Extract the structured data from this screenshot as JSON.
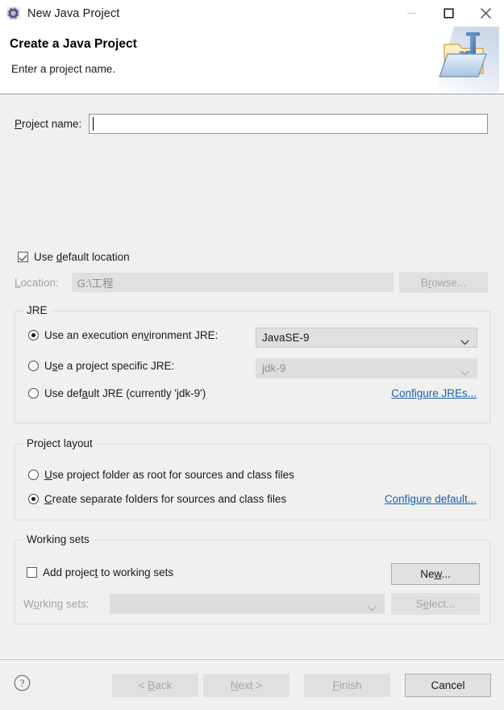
{
  "window": {
    "title": "New Java Project",
    "icon": "eclipse-gear-icon",
    "controls": {
      "minimize": "minimize-icon",
      "maximize": "maximize-icon",
      "close": "close-icon"
    }
  },
  "header": {
    "title": "Create a Java Project",
    "description": "Enter a project name.",
    "icon": "java-project-folder-icon"
  },
  "form": {
    "project_name_label": "Project name:",
    "project_name_value": "",
    "use_default_location_label": "Use default location",
    "use_default_location_checked": true,
    "location_label": "Location:",
    "location_value": "G:\\工程",
    "browse_label": "Browse..."
  },
  "jre": {
    "group_title": "JRE",
    "options": [
      {
        "label": "Use an execution environment JRE:",
        "selected": true,
        "combo_value": "JavaSE-9",
        "combo_enabled": true
      },
      {
        "label": "Use a project specific JRE:",
        "selected": false,
        "combo_value": "jdk-9",
        "combo_enabled": false
      },
      {
        "label": "Use default JRE (currently 'jdk-9')",
        "selected": false
      }
    ],
    "configure_link": "Configure JREs..."
  },
  "project_layout": {
    "group_title": "Project layout",
    "options": [
      {
        "label": "Use project folder as root for sources and class files",
        "selected": false
      },
      {
        "label": "Create separate folders for sources and class files",
        "selected": true
      }
    ],
    "configure_link": "Configure default..."
  },
  "working_sets": {
    "group_title": "Working sets",
    "add_label": "Add project to working sets",
    "add_checked": false,
    "new_label": "New...",
    "sets_label": "Working sets:",
    "sets_value": "",
    "select_label": "Select..."
  },
  "footer": {
    "help_icon": "help-icon",
    "buttons": [
      {
        "label": "< Back",
        "enabled": false
      },
      {
        "label": "Next >",
        "enabled": false
      },
      {
        "label": "Finish",
        "enabled": false
      },
      {
        "label": "Cancel",
        "enabled": true
      }
    ]
  },
  "colors": {
    "dialog_bg": "#f0f0f0",
    "header_bg": "#ffffff",
    "link": "#1560ab",
    "input_border": "#7a94ab",
    "button_bg": "#e1e1e1"
  }
}
